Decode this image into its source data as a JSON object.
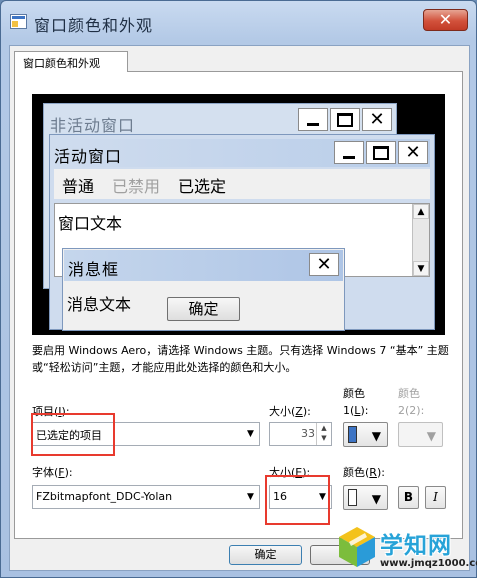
{
  "window": {
    "title": "窗口颜色和外观",
    "close_glyph": "✕"
  },
  "tab": {
    "label": "窗口颜色和外观"
  },
  "preview": {
    "inactive_title": "非活动窗口",
    "active_title": "活动窗口",
    "menu": [
      "普通",
      "已禁用",
      "已选定"
    ],
    "window_text": "窗口文本",
    "msgbox_title": "消息框",
    "msgbox_text": "消息文本",
    "msgbox_ok": "确定"
  },
  "description": "要启用 Windows Aero，请选择 Windows 主题。只有选择 Windows 7 “基本” 主题或“轻松访问”主题，才能应用此处选择的颜色和大小。",
  "item": {
    "label": "项目(",
    "key": "I",
    "label_end": "):",
    "value": "已选定的项目",
    "size_label": "大小(",
    "size_key": "Z",
    "size_label_end": "):",
    "size_value": "33",
    "color1_label": "颜色",
    "color1_sub": "1(",
    "color1_key": "L",
    "color1_end": "):",
    "color1_hex": "#3d74c4",
    "color2_label": "颜色",
    "color2_sub": "2(2):"
  },
  "font": {
    "label": "字体(",
    "key": "F",
    "label_end": "):",
    "value": "FZbitmapfont_DDC-Yolan",
    "size_label": "大小(",
    "size_key": "E",
    "size_label_end": "):",
    "size_value": "16",
    "color_label": "颜色(",
    "color_key": "R",
    "color_end": "):",
    "bold": "B",
    "italic": "I"
  },
  "buttons": {
    "ok": "确定"
  },
  "watermark": {
    "name": "学知网",
    "url": "www.jmqz1000.com"
  },
  "colors": {
    "highlight_box": "#e83a2e",
    "swatch": "#3d74c4"
  }
}
